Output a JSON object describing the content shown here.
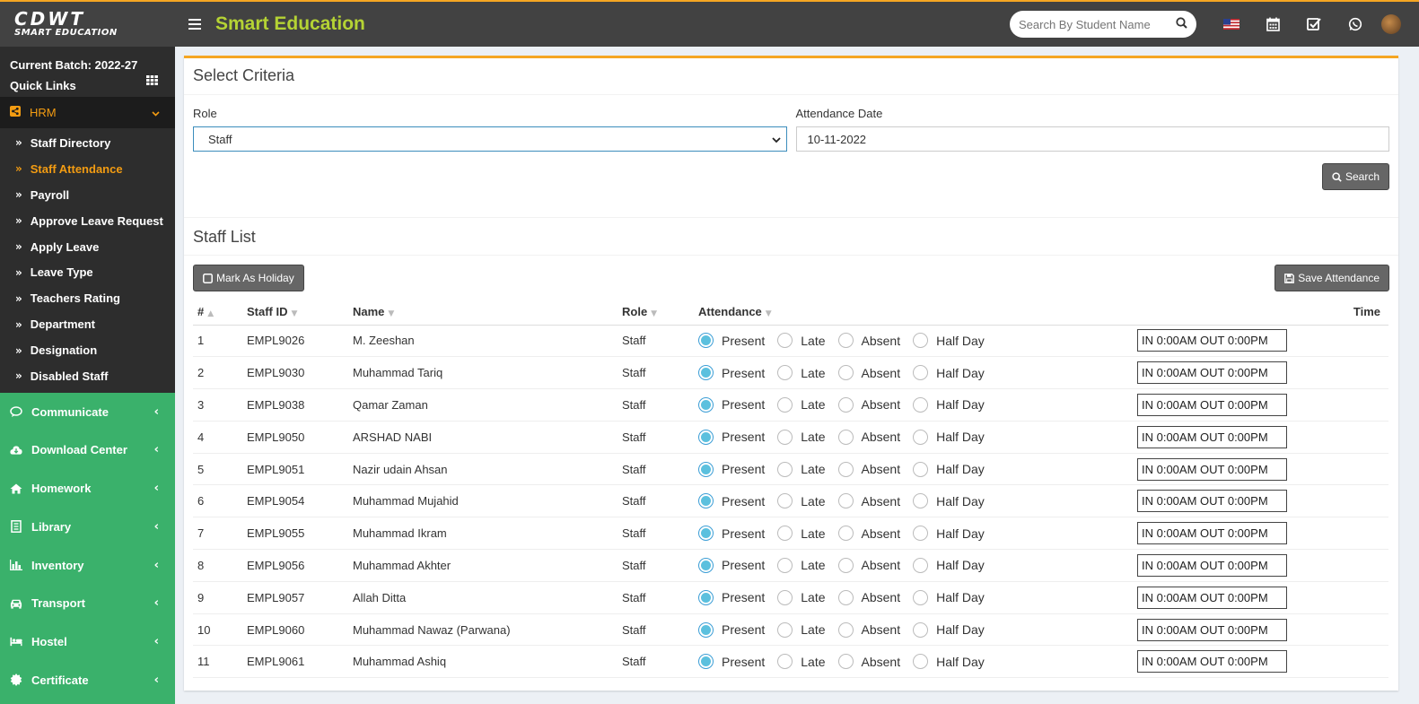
{
  "header": {
    "logo_line1": "CDWT",
    "logo_line2": "SMART EDUCATION",
    "app_title": "Smart Education",
    "search_placeholder": "Search By Student Name"
  },
  "sidebar": {
    "current_batch": "Current Batch: 2022-27",
    "quick_links": "Quick Links",
    "hrm_label": "HRM",
    "hrm_items": [
      {
        "label": "Staff Directory",
        "active": false
      },
      {
        "label": "Staff Attendance",
        "active": true
      },
      {
        "label": "Payroll",
        "active": false
      },
      {
        "label": "Approve Leave Request",
        "active": false
      },
      {
        "label": "Apply Leave",
        "active": false
      },
      {
        "label": "Leave Type",
        "active": false
      },
      {
        "label": "Teachers Rating",
        "active": false
      },
      {
        "label": "Department",
        "active": false
      },
      {
        "label": "Designation",
        "active": false
      },
      {
        "label": "Disabled Staff",
        "active": false
      }
    ],
    "modules": [
      {
        "label": "Communicate",
        "icon": "chat-icon"
      },
      {
        "label": "Download Center",
        "icon": "cloud-download-icon"
      },
      {
        "label": "Homework",
        "icon": "home-icon"
      },
      {
        "label": "Library",
        "icon": "book-icon"
      },
      {
        "label": "Inventory",
        "icon": "chart-icon"
      },
      {
        "label": "Transport",
        "icon": "car-icon"
      },
      {
        "label": "Hostel",
        "icon": "bed-icon"
      },
      {
        "label": "Certificate",
        "icon": "certificate-icon"
      }
    ]
  },
  "criteria": {
    "title": "Select Criteria",
    "role_label": "Role",
    "role_value": "Staff",
    "date_label": "Attendance Date",
    "date_value": "10-11-2022",
    "search_button": "Search"
  },
  "staff_list": {
    "title": "Staff List",
    "holiday_button": "Mark As Holiday",
    "save_button": "Save Attendance",
    "columns": {
      "num": "#",
      "staff_id": "Staff ID",
      "name": "Name",
      "role": "Role",
      "attendance": "Attendance",
      "time": "Time"
    },
    "attendance_options": [
      "Present",
      "Late",
      "Absent",
      "Half Day"
    ],
    "rows": [
      {
        "num": "1",
        "staff_id": "EMPL9026",
        "name": "M. Zeeshan",
        "role": "Staff",
        "attendance": "Present",
        "time": "IN 0:00AM OUT 0:00PM"
      },
      {
        "num": "2",
        "staff_id": "EMPL9030",
        "name": "Muhammad Tariq",
        "role": "Staff",
        "attendance": "Present",
        "time": "IN 0:00AM OUT 0:00PM"
      },
      {
        "num": "3",
        "staff_id": "EMPL9038",
        "name": "Qamar Zaman",
        "role": "Staff",
        "attendance": "Present",
        "time": "IN 0:00AM OUT 0:00PM"
      },
      {
        "num": "4",
        "staff_id": "EMPL9050",
        "name": "ARSHAD NABI",
        "role": "Staff",
        "attendance": "Present",
        "time": "IN 0:00AM OUT 0:00PM"
      },
      {
        "num": "5",
        "staff_id": "EMPL9051",
        "name": "Nazir udain Ahsan",
        "role": "Staff",
        "attendance": "Present",
        "time": "IN 0:00AM OUT 0:00PM"
      },
      {
        "num": "6",
        "staff_id": "EMPL9054",
        "name": "Muhammad Mujahid",
        "role": "Staff",
        "attendance": "Present",
        "time": "IN 0:00AM OUT 0:00PM"
      },
      {
        "num": "7",
        "staff_id": "EMPL9055",
        "name": "Muhammad Ikram",
        "role": "Staff",
        "attendance": "Present",
        "time": "IN 0:00AM OUT 0:00PM"
      },
      {
        "num": "8",
        "staff_id": "EMPL9056",
        "name": "Muhammad Akhter",
        "role": "Staff",
        "attendance": "Present",
        "time": "IN 0:00AM OUT 0:00PM"
      },
      {
        "num": "9",
        "staff_id": "EMPL9057",
        "name": "Allah Ditta",
        "role": "Staff",
        "attendance": "Present",
        "time": "IN 0:00AM OUT 0:00PM"
      },
      {
        "num": "10",
        "staff_id": "EMPL9060",
        "name": "Muhammad Nawaz (Parwana)",
        "role": "Staff",
        "attendance": "Present",
        "time": "IN 0:00AM OUT 0:00PM"
      },
      {
        "num": "11",
        "staff_id": "EMPL9061",
        "name": "Muhammad Ashiq",
        "role": "Staff",
        "attendance": "Present",
        "time": "IN 0:00AM OUT 0:00PM"
      }
    ]
  },
  "colors": {
    "accent": "#f5a623",
    "sidebar_green": "#3ab16b",
    "title_green": "#b5d334",
    "radio_blue": "#5bc0de"
  }
}
